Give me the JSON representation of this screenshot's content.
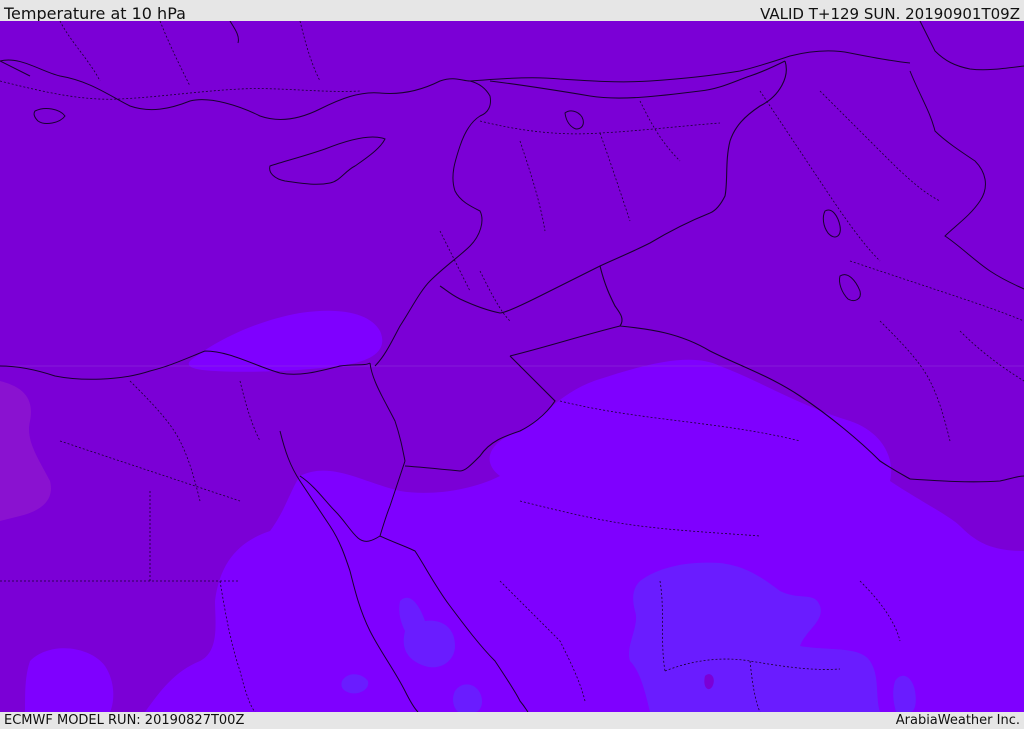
{
  "header": {
    "title": "Temperature at 10 hPa",
    "valid": "VALID T+129 SUN. 20190901T09Z"
  },
  "footer": {
    "model_run": "ECMWF MODEL RUN: 20190827T00Z",
    "brand": "ArabiaWeather Inc."
  },
  "map": {
    "colors": {
      "background_field": "#7b00d6",
      "warm_patch": "#7f00ff",
      "warmer_patch": "#6a1cff",
      "left_patch": "#8a12d0",
      "borders": "#1a0030"
    }
  }
}
